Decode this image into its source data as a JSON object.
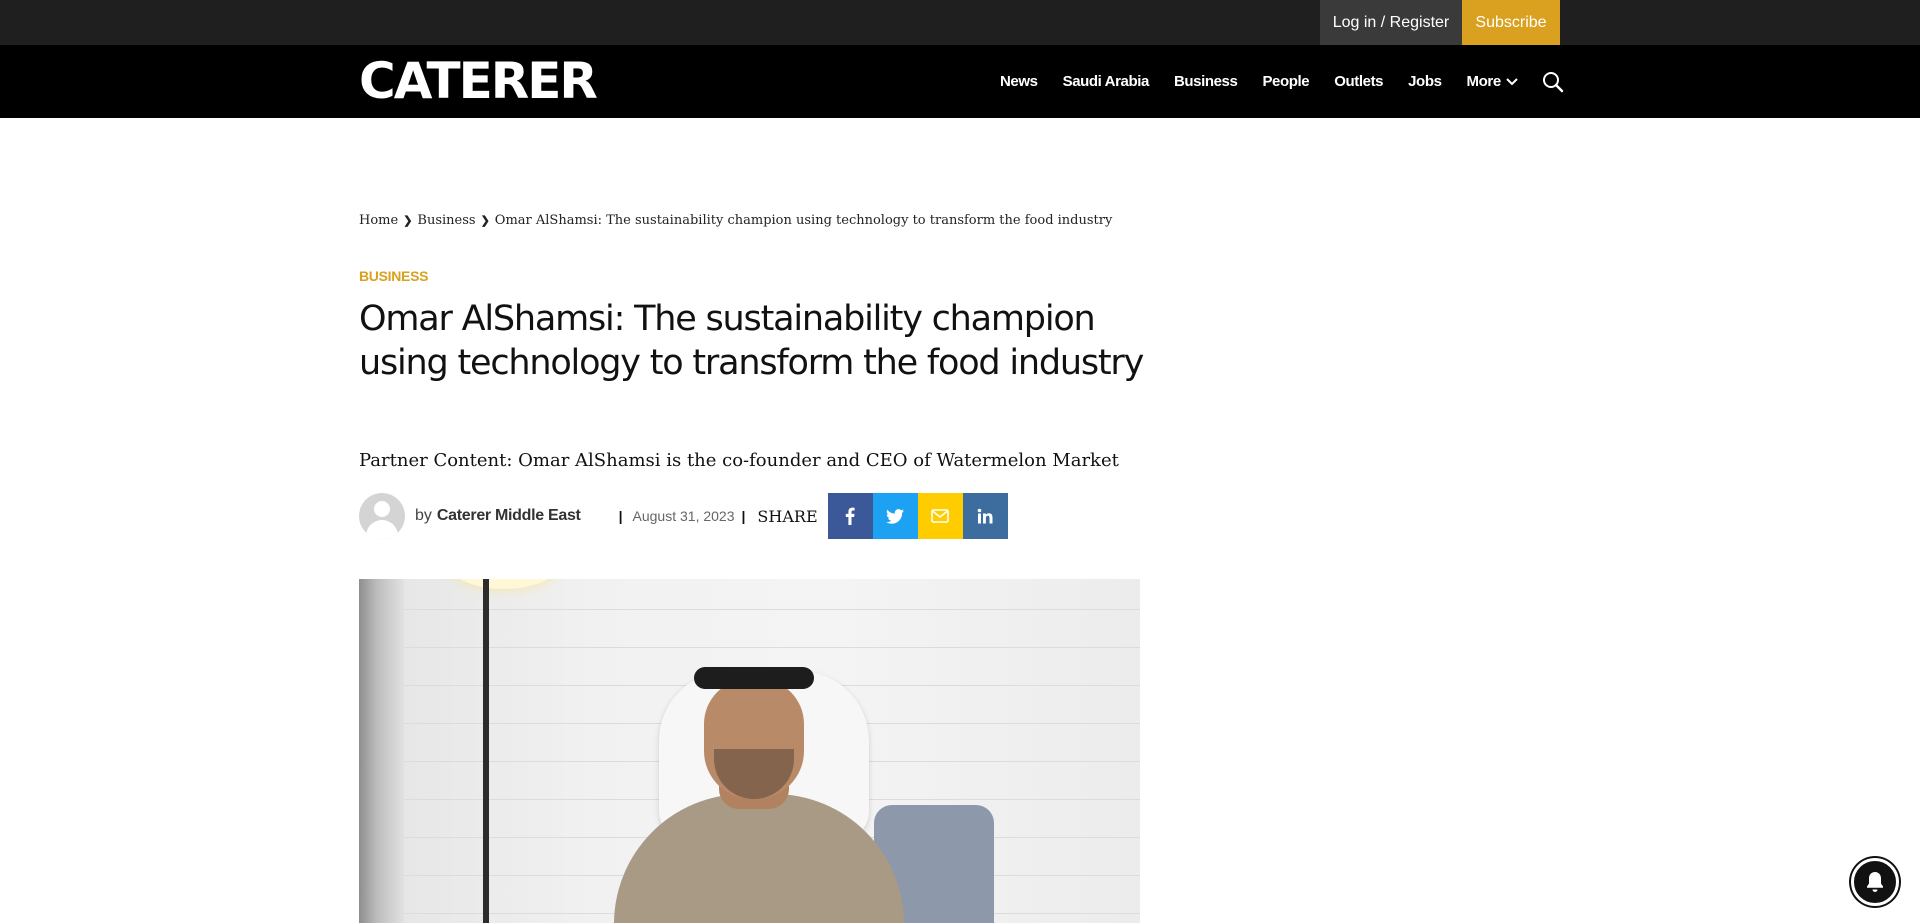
{
  "utility_bar": {
    "login_label": "Log in / Register",
    "subscribe_label": "Subscribe"
  },
  "header": {
    "logo_text": "CATERER",
    "nav_items": [
      "News",
      "Saudi Arabia",
      "Business",
      "People",
      "Outlets",
      "Jobs"
    ],
    "more_label": "More"
  },
  "breadcrumb": {
    "home": "Home",
    "section": "Business",
    "current": "Omar AlShamsi: The sustainability champion using technology to transform the food industry"
  },
  "article": {
    "category": "BUSINESS",
    "headline": "Omar AlShamsi: The sustainability champion using technology to transform the food industry",
    "subheadline": "Partner Content: Omar AlShamsi is the co-founder and CEO of Watermelon Market",
    "by_label": "by",
    "author": "Caterer Middle East",
    "date": "August 31, 2023",
    "share_label": "SHARE"
  },
  "icons": {
    "search": "search-icon",
    "more_chevron": "chevron-down-icon",
    "facebook": "facebook-icon",
    "twitter": "twitter-icon",
    "email": "email-icon",
    "linkedin": "linkedin-icon",
    "bell": "bell-icon"
  },
  "colors": {
    "accent": "#d9a11f",
    "nav_bg": "#000000",
    "utility_bg": "#1f1f1f",
    "facebook": "#3b5998",
    "twitter": "#1da1f2",
    "email": "#ffcc00",
    "linkedin": "#3d6d9e"
  }
}
